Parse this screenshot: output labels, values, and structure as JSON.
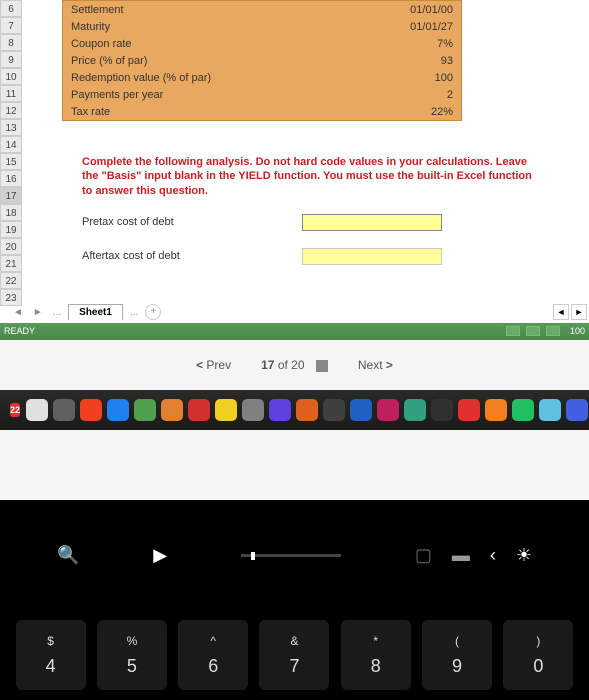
{
  "rows": [
    "6",
    "7",
    "8",
    "9",
    "10",
    "11",
    "12",
    "13",
    "14",
    "15",
    "16",
    "17",
    "18",
    "19",
    "20",
    "21",
    "22",
    "23"
  ],
  "active_row": "17",
  "orange": {
    "rows": [
      {
        "label": "Settlement",
        "value": "01/01/00"
      },
      {
        "label": "Maturity",
        "value": "01/01/27"
      },
      {
        "label": "Coupon rate",
        "value": "7%"
      },
      {
        "label": "Price (% of par)",
        "value": "93"
      },
      {
        "label": "Redemption value (% of par)",
        "value": "100"
      },
      {
        "label": "Payments per year",
        "value": "2"
      },
      {
        "label": "Tax rate",
        "value": "22%"
      }
    ]
  },
  "instructions": "Complete the following analysis. Do not hard code values in your calculations. Leave the \"Basis\" input blank in the YIELD function. You must use the built-in Excel function to answer this question.",
  "pretax_label": "Pretax cost of debt",
  "aftertax_label": "Aftertax cost of debt",
  "sheet_tab": "Sheet1",
  "tab_more": "...",
  "add_sheet": "+",
  "status": "READY",
  "zoom": "100",
  "nav": {
    "prev": "Prev",
    "page": "17",
    "of": "of",
    "total": "20",
    "next": "Next"
  },
  "badge": "22",
  "keys": [
    {
      "top": "$",
      "bottom": "4"
    },
    {
      "top": "%",
      "bottom": "5"
    },
    {
      "top": "^",
      "bottom": "6"
    },
    {
      "top": "&",
      "bottom": "7"
    },
    {
      "top": "*",
      "bottom": "8"
    },
    {
      "top": "(",
      "bottom": "9"
    },
    {
      "top": ")",
      "bottom": "0"
    }
  ],
  "dock_colors": [
    "#e0e0e0",
    "#606060",
    "#f04020",
    "#2080f0",
    "#50a050",
    "#e08030",
    "#d03030",
    "#f0d020",
    "#808080",
    "#6040e0",
    "#e06020",
    "#404040",
    "#2060c0",
    "#c02060",
    "#30a080",
    "#303030",
    "#e03030",
    "#f08020",
    "#20c060",
    "#60c0e0",
    "#4060e0"
  ]
}
